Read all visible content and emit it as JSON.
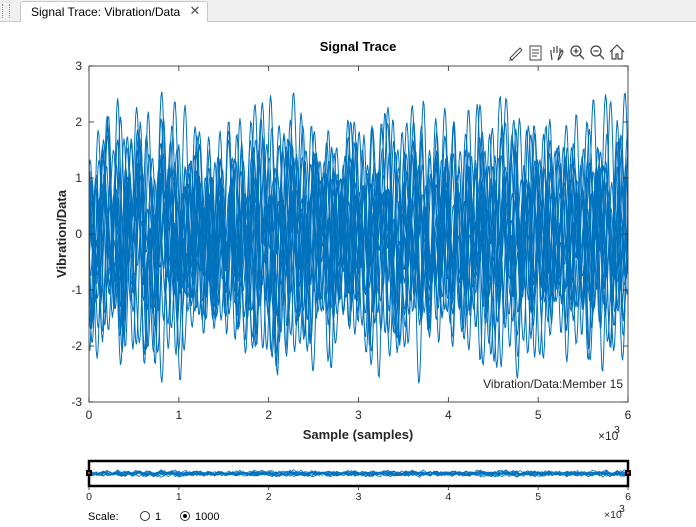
{
  "tab": {
    "title": "Signal Trace: Vibration/Data",
    "close_glyph": "✕"
  },
  "toolbar": {
    "icons": [
      "brush-icon",
      "data-tips-icon",
      "pan-icon",
      "zoom-in-icon",
      "zoom-out-icon",
      "home-icon"
    ]
  },
  "colors": {
    "signal": "#0072bd",
    "axis": "#262626",
    "selection": "#000000"
  },
  "plot": {
    "title": "Signal Trace",
    "xlabel": "Sample (samples)",
    "ylabel": "Vibration/Data",
    "x_exponent_base": "×10",
    "x_exponent_power": "3",
    "xticks": [
      "0",
      "1",
      "2",
      "3",
      "4",
      "5",
      "6"
    ],
    "yticks": [
      "3",
      "2",
      "1",
      "0",
      "-1",
      "-2",
      "-3"
    ],
    "annotation": "Vibration/Data:Member 15"
  },
  "overview": {
    "xticks": [
      "0",
      "1",
      "2",
      "3",
      "4",
      "5",
      "6"
    ],
    "x_exponent_base": "×10",
    "x_exponent_power": "3"
  },
  "scale": {
    "label": "Scale:",
    "options": [
      "1",
      "1000"
    ],
    "selected": "1000"
  },
  "chart_data": {
    "type": "line",
    "title": "Signal Trace",
    "xlabel": "Sample (samples)",
    "ylabel": "Vibration/Data",
    "xlim": [
      0,
      6000
    ],
    "ylim": [
      -3,
      3
    ],
    "x_multiplier": 1000,
    "y_range_of_traces": [
      -2.8,
      2.8
    ],
    "series_count_visible": "many overlapping traces",
    "annotation": "Vibration/Data:Member 15"
  }
}
